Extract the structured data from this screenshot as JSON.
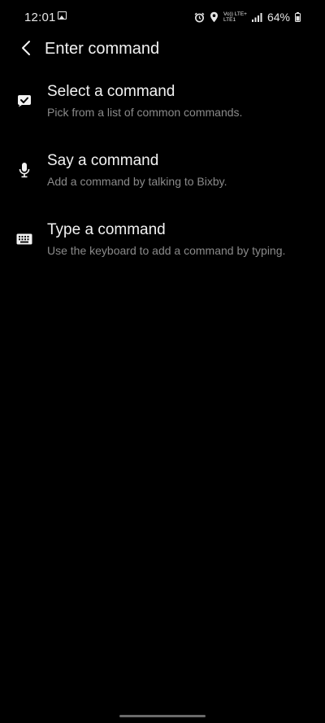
{
  "status_bar": {
    "time": "12:01",
    "network_top": "Vo)) LTE+",
    "network_bottom": "LTE1",
    "battery": "64%",
    "icons": [
      "gallery-icon",
      "alarm-icon",
      "location-icon",
      "signal-icon",
      "battery-icon"
    ]
  },
  "header": {
    "title": "Enter command",
    "back_icon": "chevron-left-icon"
  },
  "options": [
    {
      "icon": "checkmark-bubble-icon",
      "title": "Select a command",
      "description": "Pick from a list of common commands."
    },
    {
      "icon": "microphone-icon",
      "title": "Say a command",
      "description": "Add a command by talking to Bixby."
    },
    {
      "icon": "keyboard-icon",
      "title": "Type a command",
      "description": "Use the keyboard to add a command by typing."
    }
  ],
  "colors": {
    "background": "#000000",
    "primary_text": "#f2f2f2",
    "secondary_text": "#8a8a8a"
  }
}
